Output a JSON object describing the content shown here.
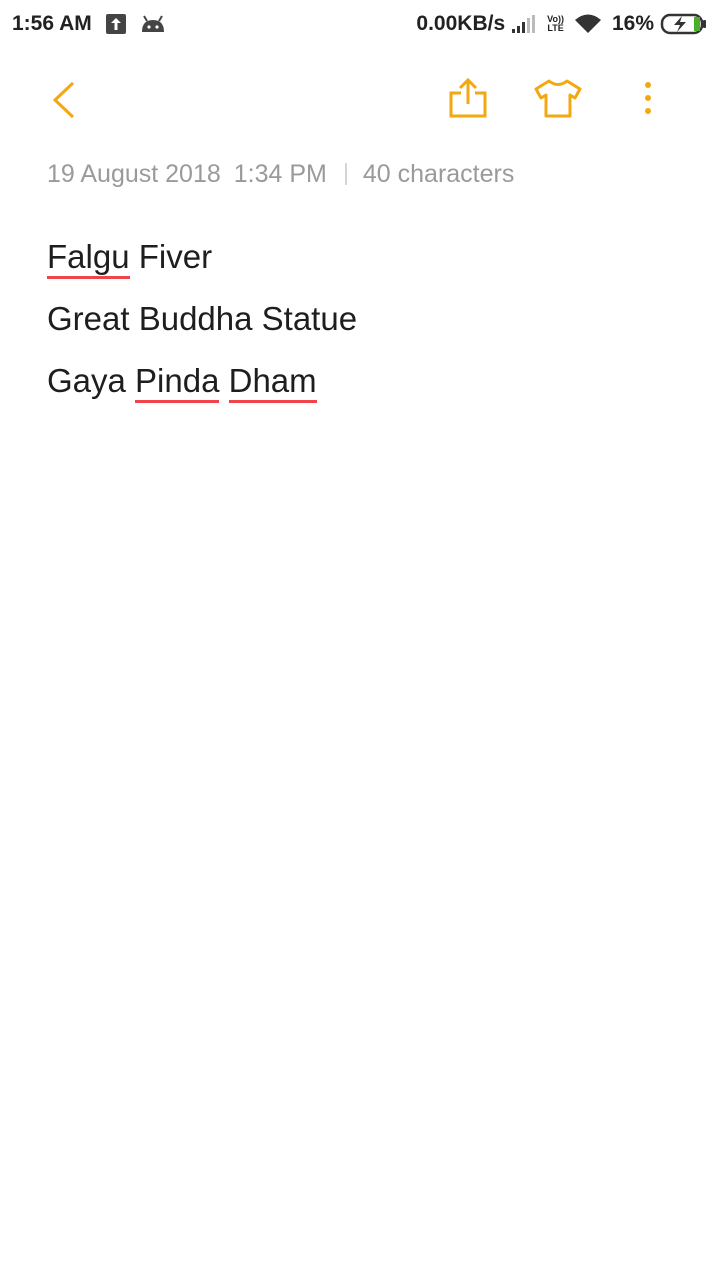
{
  "status_bar": {
    "time": "1:56 AM",
    "network_speed": "0.00KB/s",
    "volte_top": "Vo))",
    "volte_bottom": "LTE",
    "battery_percent": "16%",
    "icons": [
      "upload-icon",
      "android-icon",
      "signal-icon",
      "volte-icon",
      "wifi-icon",
      "battery-charging-icon"
    ]
  },
  "toolbar": {
    "accent_color": "#f3a711",
    "icons": [
      "back-chevron-icon",
      "share-icon",
      "tshirt-theme-icon",
      "more-vert-icon"
    ]
  },
  "meta": {
    "date": "19 August 2018",
    "time": "1:34 PM",
    "char_count": "40 characters"
  },
  "note": {
    "lines": [
      {
        "misspelled": "Falgu",
        "rest": " Fiver"
      },
      {
        "text": "Great Buddha Statue"
      },
      {
        "plain": "Gaya ",
        "misspelled_1": "Pinda",
        "space": " ",
        "misspelled_2": "Dham"
      }
    ],
    "spellcheck_color": "#f0444a"
  }
}
